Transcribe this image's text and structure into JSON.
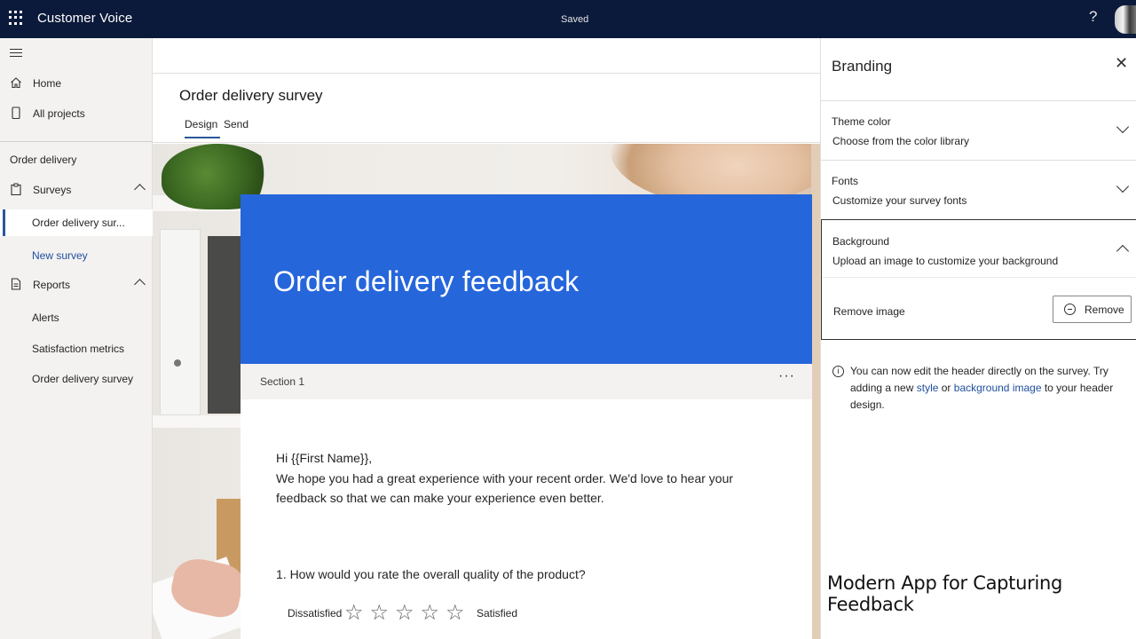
{
  "topbar": {
    "app_title": "Customer Voice",
    "status": "Saved",
    "help_label": "?"
  },
  "sidebar": {
    "nav": [
      {
        "label": "Home",
        "icon": "home-icon"
      },
      {
        "label": "All projects",
        "icon": "phone-icon"
      }
    ],
    "project_label": "Order delivery",
    "surveys_label": "Surveys",
    "survey_items": [
      {
        "label": "Order delivery sur...",
        "active": true
      },
      {
        "label": "New survey",
        "link": true
      }
    ],
    "reports_label": "Reports",
    "report_items": [
      "Alerts",
      "Satisfaction metrics",
      "Order delivery survey"
    ]
  },
  "page": {
    "title": "Order delivery survey",
    "tabs": [
      "Design",
      "Send"
    ],
    "active_tab": "Design"
  },
  "survey": {
    "header_title": "Order delivery feedback",
    "header_color": "#2666db",
    "section_label": "Section 1",
    "more_label": "···",
    "greeting_line1": "Hi {{First Name}},",
    "greeting_line2": "We hope you had a great experience with your recent order. We'd love to hear your feedback so that we can make your experience even better.",
    "question": "1. How would you rate the overall quality of the product?",
    "rating_low": "Dissatisfied",
    "rating_high": "Satisfied",
    "star_glyph": "☆"
  },
  "branding": {
    "title": "Branding",
    "close_glyph": "✕",
    "theme_color": {
      "heading": "Theme color",
      "description": "Choose from the color library"
    },
    "fonts": {
      "heading": "Fonts",
      "description": "Customize your survey fonts"
    },
    "background": {
      "heading": "Background",
      "description": "Upload an image to customize your background"
    },
    "remove_image_label": "Remove image",
    "remove_button": "Remove",
    "info_prefix": "You can now edit the header directly on the survey. Try adding a new ",
    "info_link1": "style",
    "info_mid": " or ",
    "info_link2": "background image",
    "info_suffix": " to your header design."
  },
  "caption": "Modern App for Capturing Feedback",
  "colors": {
    "topbar": "#0b1a3a",
    "accent": "#2b579a",
    "link": "#1f4e9c"
  }
}
